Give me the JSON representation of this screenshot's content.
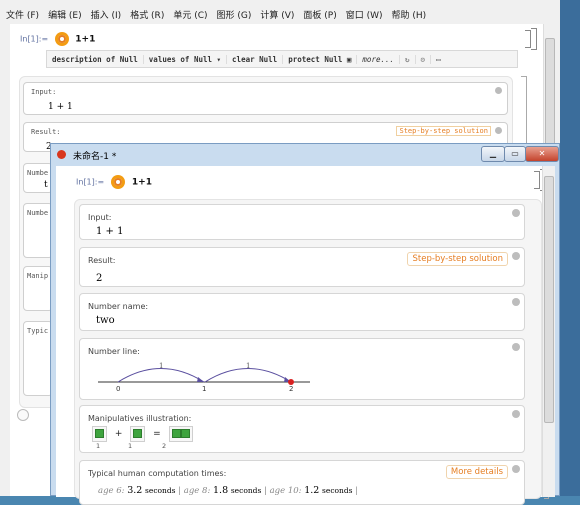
{
  "menu": [
    "文件 (F)",
    "编辑 (E)",
    "插入 (I)",
    "格式 (R)",
    "单元 (C)",
    "图形 (G)",
    "计算 (V)",
    "面板 (P)",
    "窗口 (W)",
    "帮助 (H)"
  ],
  "bg_notebook": {
    "in_label": "In[1]:=",
    "input": "1+1",
    "toolbar": [
      "description of Null",
      "values of Null",
      "clear Null",
      "protect Null",
      "more..."
    ],
    "pods": {
      "input_title": "Input:",
      "input_value": "1 + 1",
      "result_title": "Result:",
      "step_by_step": "Step-by-step solution",
      "result_value": "2",
      "number_name_title": "Numbe",
      "number_name_value": "t",
      "number_line_title": "Numbe",
      "manip_title": "Manip",
      "typical_title": "Typic"
    }
  },
  "front_window": {
    "title": "未命名-1 *",
    "in_label": "In[1]:=",
    "input": "1+1",
    "pods": {
      "input": {
        "title": "Input:",
        "value": "1 + 1"
      },
      "result": {
        "title": "Result:",
        "value": "2",
        "button": "Step-by-step solution"
      },
      "number_name": {
        "title": "Number name:",
        "value": "two"
      },
      "number_line": {
        "title": "Number line:",
        "ticks": [
          "0",
          "1",
          "2"
        ],
        "arc_labels": [
          "1",
          "1"
        ]
      },
      "manipulatives": {
        "title": "Manipulatives illustration:",
        "plus": "+",
        "equals": "=",
        "labels": [
          "1",
          "1",
          "2"
        ]
      },
      "typical_times": {
        "title": "Typical human computation times:",
        "button": "More details",
        "entries": [
          {
            "age": "age 6:",
            "value": "3.2",
            "unit": "seconds"
          },
          {
            "age": "age 8:",
            "value": "1.8",
            "unit": "seconds"
          },
          {
            "age": "age 10:",
            "value": "1.2",
            "unit": "seconds"
          }
        ]
      }
    }
  },
  "colors": {
    "accent_orange": "#e67e22",
    "number_line_arrow": "#5a4f9f",
    "point_red": "#d82020",
    "manip_green": "#3ea43e"
  }
}
